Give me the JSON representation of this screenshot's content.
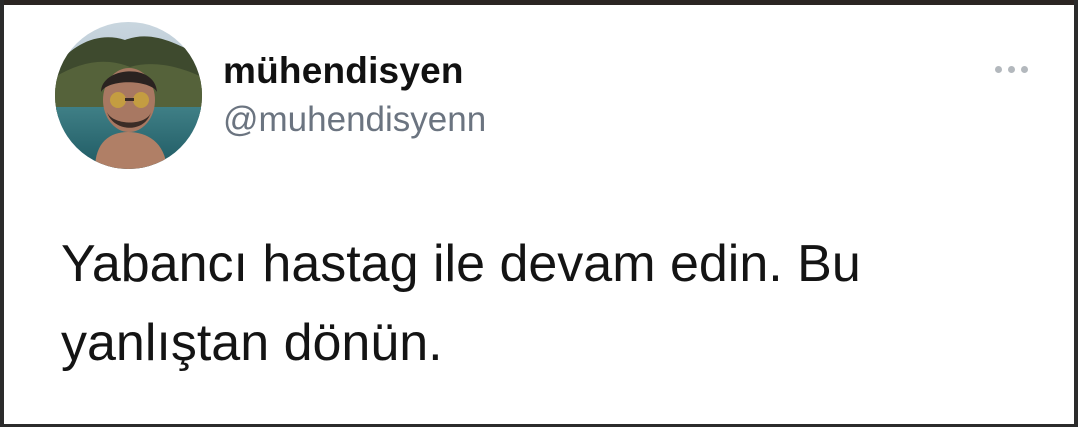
{
  "tweet": {
    "author": {
      "display_name": "mühendisyen",
      "handle": "@muhendisyenn"
    },
    "text_lines": [
      "Yabancı hastag ile devam edin. Bu",
      "yanlıştan dönün."
    ],
    "more_icon": "more-horizontal-icon"
  },
  "colors": {
    "name": "#111111",
    "handle": "#6b7480",
    "text": "#141414",
    "more_dots": "#b3b8bd"
  }
}
